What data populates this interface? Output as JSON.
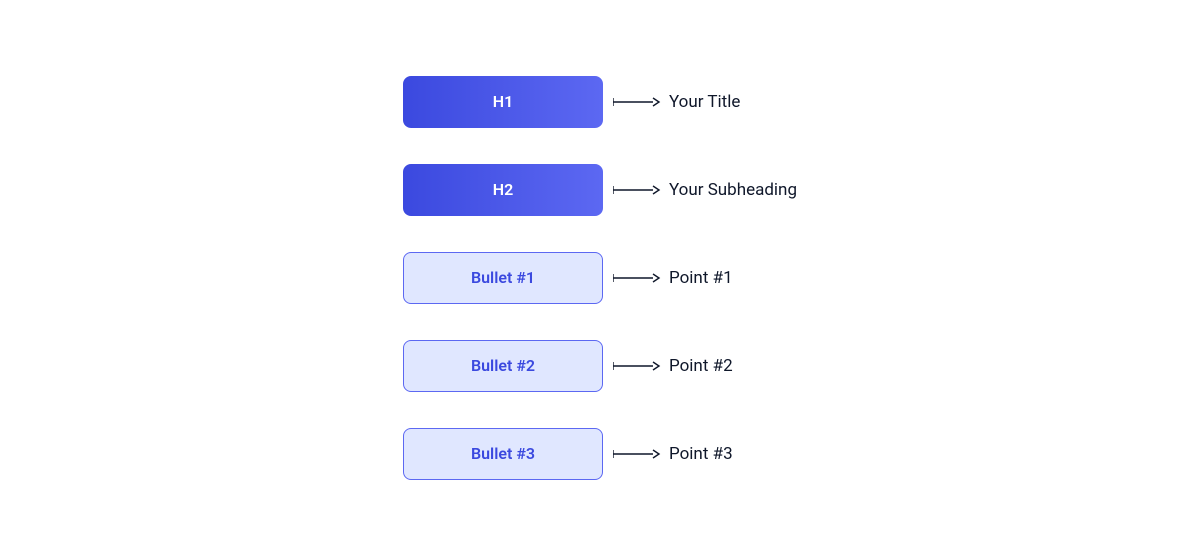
{
  "rows": [
    {
      "box_label": "H1",
      "box_variant": "primary",
      "description": "Your Title"
    },
    {
      "box_label": "H2",
      "box_variant": "primary",
      "description": "Your Subheading"
    },
    {
      "box_label": "Bullet #1",
      "box_variant": "secondary",
      "description": "Point #1"
    },
    {
      "box_label": "Bullet #2",
      "box_variant": "secondary",
      "description": "Point #2"
    },
    {
      "box_label": "Bullet #3",
      "box_variant": "secondary",
      "description": "Point #3"
    }
  ],
  "colors": {
    "primary_gradient_start": "#3b49df",
    "primary_gradient_end": "#5c68f2",
    "secondary_bg": "#e0e7ff",
    "secondary_border": "#5c68f2",
    "secondary_text": "#3b49df",
    "label_text": "#0f172a",
    "arrow": "#0f172a"
  }
}
